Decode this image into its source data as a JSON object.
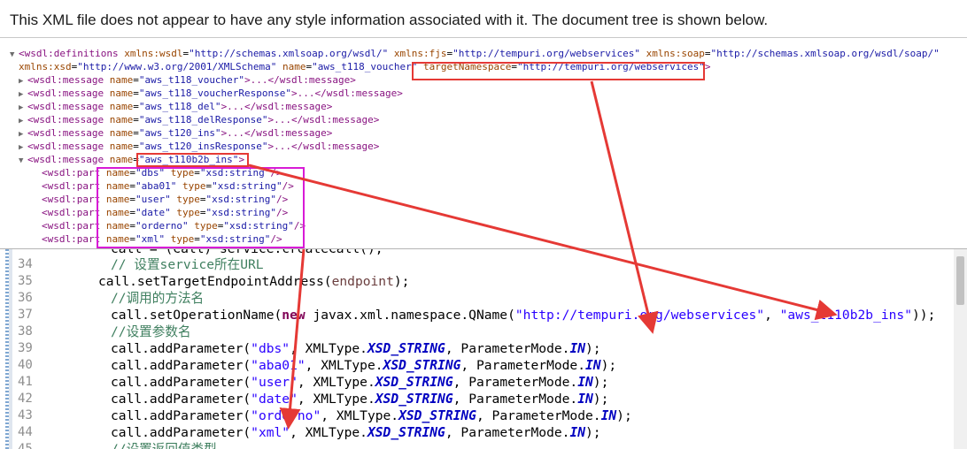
{
  "xml_viewer": {
    "info": "This XML file does not appear to have any style information associated with it. The document tree is shown below.",
    "toggle_open": "▼",
    "toggle_closed": "▶",
    "definitions": {
      "l1_prefix": "<wsdl:definitions ",
      "a1": "xmlns:wsdl",
      "v1": "\"http://schemas.xmlsoap.org/wsdl/\"",
      "a2": "xmlns:fjs",
      "v2": "\"http://tempuri.org/webservices\"",
      "a3": "xmlns:soap",
      "v3": "\"http://schemas.xmlsoap.org/wsdl/soap/\"",
      "a4": "xmlns:xsd",
      "v4": "\"http://www.w3.org/2001/XMLSchema\"",
      "a5": "name",
      "v5": "\"aws_t118_voucher\"",
      "a6": "targetNamespace",
      "v6": "\"http://tempuri.org/webservices\"",
      "close": ">"
    },
    "messages": [
      {
        "name": "\"aws_t118_voucher\""
      },
      {
        "name": "\"aws_t118_voucherResponse\""
      },
      {
        "name": "\"aws_t118_del\""
      },
      {
        "name": "\"aws_t118_delResponse\""
      },
      {
        "name": "\"aws_t120_ins\""
      },
      {
        "name": "\"aws_t120_insResponse\""
      }
    ],
    "msg_open": "<wsdl:message ",
    "msg_name_attr": "name",
    "msg_collapsed_tail": ">...</wsdl:message>",
    "expanded_message": {
      "name": "\"aws_t110b2b_ins\"",
      "close": ">"
    },
    "part_open": "<wsdl:part ",
    "part_type_attr": "type",
    "part_name_attr": "name",
    "part_close": "/>",
    "parts": [
      {
        "name": "\"dbs\"",
        "type": "\"xsd:string\""
      },
      {
        "name": "\"aba01\"",
        "type": "\"xsd:string\""
      },
      {
        "name": "\"user\"",
        "type": "\"xsd:string\""
      },
      {
        "name": "\"date\"",
        "type": "\"xsd:string\""
      },
      {
        "name": "\"orderno\"",
        "type": "\"xsd:string\""
      },
      {
        "name": "\"xml\"",
        "type": "\"xsd:string\""
      }
    ]
  },
  "code": {
    "line33": {
      "num": "",
      "text": "call = (Call) service.createCall();"
    },
    "line34": {
      "num": "34",
      "text": "// 设置service所在URL"
    },
    "line35": {
      "num": "35",
      "pre": "call.setTargetEndpointAddress(",
      "var": "endpoint",
      "post": ");"
    },
    "line36": {
      "num": "36",
      "text": "//调用的方法名"
    },
    "line37": {
      "num": "37",
      "pre": "call.setOperationName(",
      "kw": "new",
      "mid": " javax.xml.namespace.QName(",
      "s1": "\"http://tempuri.org/webservices\"",
      "sep": ", ",
      "s2": "\"aws_t110b2b_ins\"",
      "post": "));"
    },
    "line38": {
      "num": "38",
      "text": "//设置参数名"
    },
    "params": [
      {
        "num": "39",
        "arg": "\"dbs\""
      },
      {
        "num": "40",
        "arg": "\"aba01\""
      },
      {
        "num": "41",
        "arg": "\"user\""
      },
      {
        "num": "42",
        "arg": "\"date\""
      },
      {
        "num": "43",
        "arg": "\"orderno\""
      },
      {
        "num": "44",
        "arg": "\"xml\""
      }
    ],
    "param_pre": "call.addParameter(",
    "param_type_cls": ", XMLType.",
    "param_field": "XSD_STRING",
    "param_mode_cls": ", ParameterMode.",
    "param_mode": "IN",
    "param_post": ");",
    "line45": {
      "num": "45",
      "text": "//设置返回值类型"
    }
  },
  "annotation_colors": {
    "red": "#e53935",
    "pink": "#d81bd6"
  }
}
